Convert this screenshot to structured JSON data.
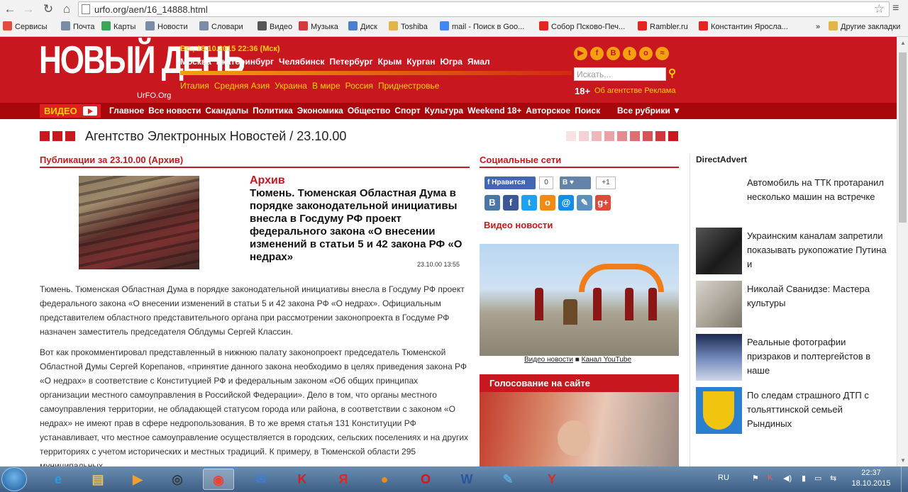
{
  "browser": {
    "url": "urfo.org/aen/16_14888.html",
    "back_icon": "arrow-left",
    "forward_icon": "arrow-right",
    "reload_icon": "reload",
    "home_icon": "home",
    "star_icon": "star",
    "menu_icon": "hamburger",
    "bookmarks": [
      {
        "label": "Сервисы",
        "icon": "apps-icon",
        "color": "#e54b3c"
      },
      {
        "label": "Почта",
        "icon": "page-icon",
        "color": "#7a8da8"
      },
      {
        "label": "Карты",
        "icon": "maps-icon",
        "color": "#3aa757"
      },
      {
        "label": "Новости",
        "icon": "page-icon",
        "color": "#7a8da8"
      },
      {
        "label": "Словари",
        "icon": "page-icon",
        "color": "#7a8da8"
      },
      {
        "label": "Видео",
        "icon": "video-icon",
        "color": "#555555"
      },
      {
        "label": "Музыка",
        "icon": "music-icon",
        "color": "#d33b3b"
      },
      {
        "label": "Диск",
        "icon": "disk-icon",
        "color": "#4a7fd0"
      },
      {
        "label": "Toshiba",
        "icon": "folder-icon",
        "color": "#e2b646"
      },
      {
        "label": "mail - Поиск в Goo...",
        "icon": "google-icon",
        "color": "#4285f4"
      },
      {
        "label": "Собор Псково-Печ...",
        "icon": "yandex-icon",
        "color": "#e52620"
      },
      {
        "label": "Rambler.ru",
        "icon": "yandex-icon",
        "color": "#e52620"
      },
      {
        "label": "Константин Яросла...",
        "icon": "yandex-icon",
        "color": "#e52620"
      },
      {
        "label": "Другие закладки",
        "icon": "folder-icon",
        "color": "#e2b646"
      }
    ],
    "more_bookmarks": "»"
  },
  "site": {
    "logo": "НОВЫЙ ДЕНЬ",
    "logo_sub": "UrFO.Org",
    "date": "Вс., 18.10.2015 22:36 (Мск)",
    "cities": [
      "Москва",
      "Екатеринбург",
      "Челябинск",
      "Петербург",
      "Крым",
      "Курган",
      "Югра",
      "Ямал"
    ],
    "regions": [
      "Италия",
      "Средняя Азия",
      "Украина",
      "В мире",
      "Россия",
      "Приднестровье"
    ],
    "social_icons": [
      "youtube-icon",
      "facebook-icon",
      "vk-icon",
      "twitter-icon",
      "odnoklassniki-icon",
      "rss-icon"
    ],
    "social_glyphs": [
      "▶",
      "f",
      "B",
      "t",
      "o",
      "≈"
    ],
    "search_placeholder": "Искать...",
    "age": "18+",
    "about": "Об агентстве",
    "ads": "Реклама",
    "video_label": "ВИДЕО",
    "menu": [
      "Главное",
      "Все новости",
      "Скандалы",
      "Политика",
      "Экономика",
      "Общество",
      "Спорт",
      "Культура",
      "Weekend 18+",
      "Авторское",
      "Поиск"
    ],
    "all_rubrics": "Все рубрики ▼",
    "accent": "#c8171e",
    "yellow": "#ffd400"
  },
  "banner": {
    "title": "Агентство Электронных Новостей / 23.10.00"
  },
  "article": {
    "section": "Публикации за 23.10.00 (Архив)",
    "rubric": "Архив",
    "title": "Тюмень. Тюменская Областная Дума в порядке законодательной инициативы внесла в Госдуму РФ проект федерального закона «О внесении изменений в статьи 5 и 42 закона РФ «О недрах»",
    "date": "23.10.00 13:55",
    "p1": "Тюмень. Тюменская Областная Дума в порядке законодательной инициативы внесла в Госдуму РФ проект федерального закона «О внесении изменений в статьи 5 и 42 закона РФ «О недрах». Официальным представителем областного представительного органа при рассмотрении законопроекта в Госдуме РФ назначен заместитель председателя Облдумы Сергей Классин.",
    "p2": "Вот как прокомментировал представленный в нижнюю палату законопроект председатель Тюменской Областной Думы Сергей Корепанов, «принятие данного закона необходимо в целях приведения закона РФ «О недрах» в соответствие с Конституцией РФ и федеральным законом «Об общих принципах организации местного самоуправления в Российской Федерации». Дело в том, что органы местного самоуправления территории, не обладающей статусом города или района, в соответствии с законом «О недрах» не имеют прав в сфере недропользования. В то же время статья 131 Конституции РФ устанавливает, что местное самоуправление осуществляется в городских, сельских поселениях и на других территориях с учетом исторических и местных традиций. К примеру, в Тюменской области 295 муниципальных"
  },
  "sidebar": {
    "social_title": "Социальные сети",
    "fb_like": "Нравится",
    "fb_count": "0",
    "vk_label": "В",
    "vk_count": "+1",
    "share_icons": [
      "vk-share-icon",
      "facebook-share-icon",
      "twitter-share-icon",
      "odnoklassniki-share-icon",
      "mail-share-icon",
      "livejournal-share-icon",
      "google-plus-share-icon"
    ],
    "share_glyphs": [
      "В",
      "f",
      "t",
      "о",
      "@",
      "✎",
      "g+"
    ],
    "share_colors": [
      "#4a76a8",
      "#3b5998",
      "#1da1f2",
      "#f08a10",
      "#168de2",
      "#5c8fc0",
      "#dc4a38"
    ],
    "video_title": "Видео новости",
    "video_link": "Видео новости",
    "video_sep": "■",
    "youtube_link": "Канал YouTube",
    "vote_title": "Голосование на сайте"
  },
  "directadvert": {
    "title": "DirectAdvert",
    "items": [
      {
        "text": "Автомобиль на ТТК протаранил несколько машин на встречке"
      },
      {
        "text": "Украинским каналам запретили показывать рукопожатие Путина и"
      },
      {
        "text": "Николай Сванидзе: Мастера культуры"
      },
      {
        "text": "Реальные фотографии призраков и полтергейстов в наше"
      },
      {
        "text": "По следам страшного ДТП с тольяттинской семьей Рындиных"
      }
    ]
  },
  "taskbar": {
    "apps": [
      "internet-explorer-icon",
      "file-explorer-icon",
      "media-player-icon",
      "media-center-icon",
      "chrome-icon",
      "mail-icon",
      "kaspersky-icon",
      "yandex-icon",
      "ok-icon",
      "opera-icon",
      "word-icon",
      "paint-icon",
      "yandex-browser-icon"
    ],
    "glyphs": [
      "e",
      "▤",
      "▶",
      "◎",
      "◉",
      "✉",
      "K",
      "Я",
      "●",
      "O",
      "W",
      "✎",
      "Y"
    ],
    "colors": [
      "#2b9be0",
      "#e5c35a",
      "#f0a030",
      "#3a3a3a",
      "#e84334",
      "#3c7fd4",
      "#d41e2a",
      "#e52620",
      "#f08a10",
      "#e0101c",
      "#2a5699",
      "#58a8d8",
      "#e52620"
    ],
    "lang": "RU",
    "time": "22:37",
    "date": "18.10.2015"
  }
}
